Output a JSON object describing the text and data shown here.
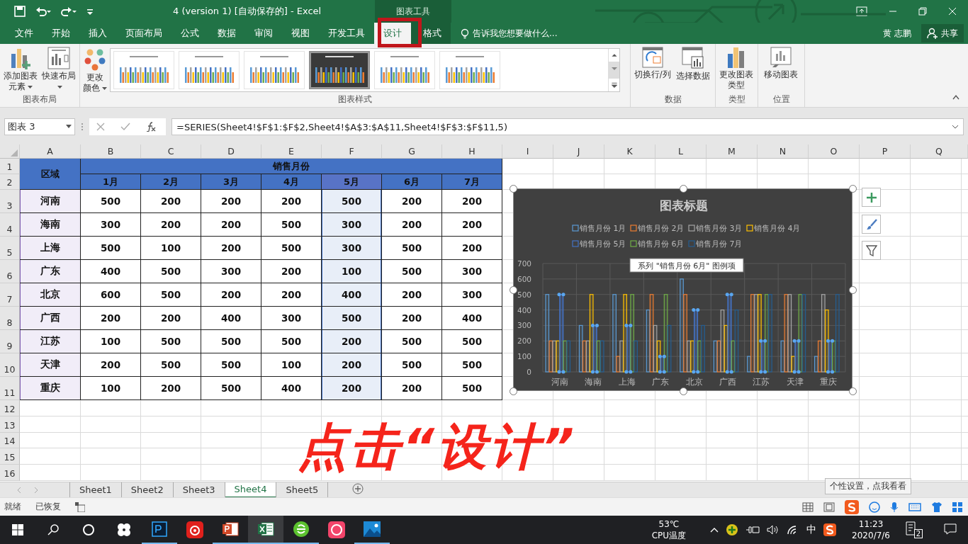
{
  "title_bar": {
    "title": "4 (version 1) [自动保存的] - Excel",
    "contextual_tab": "图表工具",
    "user": "黄 志鹏",
    "share": "共享"
  },
  "ribbon_tabs": [
    {
      "label": "文件",
      "selected": false
    },
    {
      "label": "开始",
      "selected": false
    },
    {
      "label": "插入",
      "selected": false
    },
    {
      "label": "页面布局",
      "selected": false
    },
    {
      "label": "公式",
      "selected": false
    },
    {
      "label": "数据",
      "selected": false
    },
    {
      "label": "审阅",
      "selected": false
    },
    {
      "label": "视图",
      "selected": false
    },
    {
      "label": "开发工具",
      "selected": false
    },
    {
      "label": "设计",
      "selected": true
    },
    {
      "label": "格式",
      "selected": false
    }
  ],
  "tell_me": "告诉我您想要做什么...",
  "ribbon": {
    "layout_group": {
      "label": "图表布局",
      "buttons": [
        "添加图表元素",
        "快速布局"
      ]
    },
    "styles_group": {
      "label": "图表样式",
      "color_button": "更改颜色",
      "styles": [
        {
          "selected": false
        },
        {
          "selected": false
        },
        {
          "selected": false
        },
        {
          "selected": true
        },
        {
          "selected": false
        },
        {
          "selected": false
        }
      ]
    },
    "data_group": {
      "label": "数据",
      "buttons": [
        "切换行/列",
        "选择数据"
      ]
    },
    "type_group": {
      "label": "类型",
      "button": "更改图表类型"
    },
    "location_group": {
      "label": "位置",
      "button": "移动图表"
    }
  },
  "formula_bar": {
    "name_box": "图表 3",
    "formula": "=SERIES(Sheet4!$F$1:$F$2,Sheet4!$A$3:$A$11,Sheet4!$F$3:$F$11,5)"
  },
  "columns": [
    "A",
    "B",
    "C",
    "D",
    "E",
    "F",
    "G",
    "H",
    "I",
    "J",
    "K",
    "L",
    "M",
    "N",
    "O",
    "P",
    "Q"
  ],
  "row_numbers": [
    "1",
    "2",
    "3",
    "4",
    "5",
    "6",
    "7",
    "8",
    "9",
    "10",
    "11",
    "12",
    "13",
    "14",
    "15",
    "16"
  ],
  "table": {
    "region_header": "区域",
    "group_header": "销售月份",
    "months": [
      {
        "label": "1月",
        "selected": false
      },
      {
        "label": "2月",
        "selected": false
      },
      {
        "label": "3月",
        "selected": false
      },
      {
        "label": "4月",
        "selected": false
      },
      {
        "label": "5月",
        "selected": true
      },
      {
        "label": "6月",
        "selected": false
      },
      {
        "label": "7月",
        "selected": false
      }
    ],
    "rows": [
      {
        "region": "河南",
        "values": [
          "500",
          "200",
          "200",
          "200",
          "500",
          "200",
          "200"
        ]
      },
      {
        "region": "海南",
        "values": [
          "300",
          "200",
          "200",
          "500",
          "300",
          "200",
          "200"
        ]
      },
      {
        "region": "上海",
        "values": [
          "500",
          "100",
          "200",
          "500",
          "300",
          "500",
          "200"
        ]
      },
      {
        "region": "广东",
        "values": [
          "400",
          "500",
          "300",
          "200",
          "100",
          "500",
          "300"
        ]
      },
      {
        "region": "北京",
        "values": [
          "600",
          "500",
          "200",
          "200",
          "400",
          "200",
          "300"
        ]
      },
      {
        "region": "广西",
        "values": [
          "200",
          "200",
          "400",
          "300",
          "500",
          "200",
          "400"
        ]
      },
      {
        "region": "江苏",
        "values": [
          "100",
          "500",
          "500",
          "500",
          "200",
          "500",
          "500"
        ]
      },
      {
        "region": "天津",
        "values": [
          "200",
          "500",
          "500",
          "100",
          "200",
          "500",
          "500"
        ]
      },
      {
        "region": "重庆",
        "values": [
          "100",
          "200",
          "500",
          "400",
          "200",
          "200",
          "500"
        ]
      }
    ]
  },
  "chart": {
    "tooltip": "系列 \"销售月份 6月\" 图例项",
    "chart_data": {
      "type": "bar",
      "title": "图表标题",
      "categories": [
        "河南",
        "海南",
        "上海",
        "广东",
        "北京",
        "广西",
        "江苏",
        "天津",
        "重庆"
      ],
      "series": [
        {
          "name": "销售月份 1月",
          "color": "#5b9bd5",
          "values": [
            500,
            300,
            500,
            400,
            600,
            200,
            100,
            200,
            100
          ]
        },
        {
          "name": "销售月份 2月",
          "color": "#ed7d31",
          "values": [
            200,
            200,
            100,
            500,
            500,
            200,
            500,
            500,
            200
          ]
        },
        {
          "name": "销售月份 3月",
          "color": "#a5a5a5",
          "values": [
            200,
            200,
            200,
            300,
            200,
            400,
            500,
            500,
            500
          ]
        },
        {
          "name": "销售月份 4月",
          "color": "#ffc000",
          "values": [
            200,
            500,
            500,
            200,
            200,
            300,
            500,
            100,
            400
          ]
        },
        {
          "name": "销售月份 5月",
          "color": "#4472c4",
          "values": [
            500,
            300,
            300,
            100,
            400,
            500,
            200,
            200,
            200
          ]
        },
        {
          "name": "销售月份 6月",
          "color": "#70ad47",
          "values": [
            200,
            200,
            500,
            500,
            200,
            200,
            500,
            500,
            200
          ]
        },
        {
          "name": "销售月份 7月",
          "color": "#255e91",
          "values": [
            200,
            200,
            200,
            300,
            300,
            400,
            500,
            500,
            500
          ]
        }
      ],
      "ylim": [
        0,
        700
      ],
      "yticks": [
        0,
        100,
        200,
        300,
        400,
        500,
        600,
        700
      ],
      "grid": true,
      "legend": true
    },
    "series_selection": [
      {
        "selected": false
      },
      {
        "selected": false
      },
      {
        "selected": false
      },
      {
        "selected": false
      },
      {
        "selected": true
      },
      {
        "selected": false
      },
      {
        "selected": false
      }
    ]
  },
  "annotation": "点击“设计”",
  "sheet_tabs": [
    {
      "label": "Sheet1",
      "selected": false
    },
    {
      "label": "Sheet2",
      "selected": false
    },
    {
      "label": "Sheet3",
      "selected": false
    },
    {
      "label": "Sheet4",
      "selected": true
    },
    {
      "label": "Sheet5",
      "selected": false
    }
  ],
  "status_bar": {
    "items": [
      "就绪",
      "已恢复"
    ],
    "ime_tip": "个性设置，点我看看"
  },
  "taskbar": {
    "temperature": "53℃",
    "temperature_label": "CPU温度",
    "ime": "中",
    "time": "11:23",
    "date": "2020/7/6",
    "notification_count": "2"
  }
}
